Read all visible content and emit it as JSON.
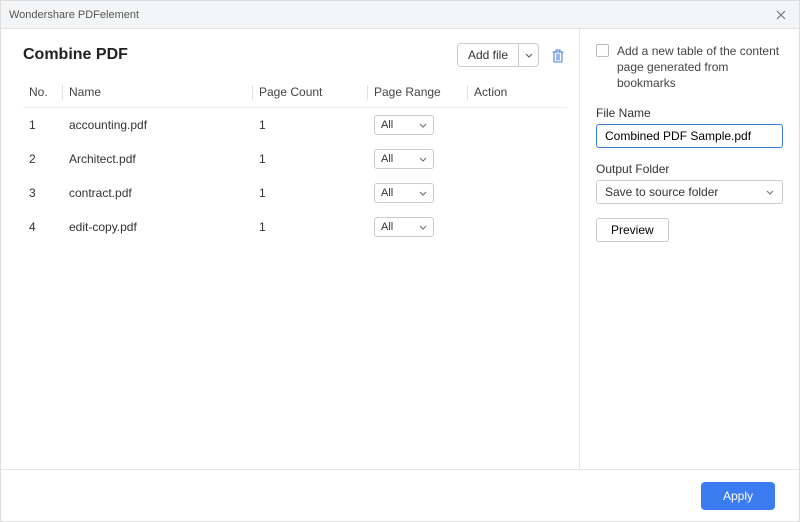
{
  "window": {
    "title": "Wondershare PDFelement"
  },
  "main": {
    "heading": "Combine PDF",
    "add_file_label": "Add file",
    "columns": {
      "no": "No.",
      "name": "Name",
      "page_count": "Page Count",
      "page_range": "Page Range",
      "action": "Action"
    },
    "range_default": "All",
    "rows": [
      {
        "no": "1",
        "name": "accounting.pdf",
        "count": "1",
        "range": "All"
      },
      {
        "no": "2",
        "name": "Architect.pdf",
        "count": "1",
        "range": "All"
      },
      {
        "no": "3",
        "name": "contract.pdf",
        "count": "1",
        "range": "All"
      },
      {
        "no": "4",
        "name": "edit-copy.pdf",
        "count": "1",
        "range": "All"
      }
    ]
  },
  "side": {
    "bookmark_checkbox_label": "Add a new table of the content page generated from bookmarks",
    "file_name_label": "File Name",
    "file_name_value": "Combined PDF Sample.pdf",
    "output_folder_label": "Output Folder",
    "output_folder_value": "Save to source folder",
    "preview_label": "Preview"
  },
  "footer": {
    "apply_label": "Apply"
  }
}
